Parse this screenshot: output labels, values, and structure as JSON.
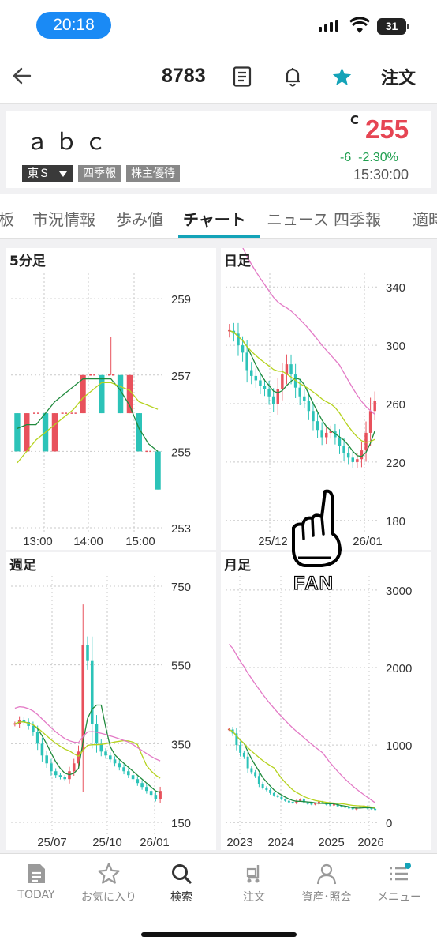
{
  "status_bar": {
    "time": "20:18",
    "battery": "31"
  },
  "header": {
    "code": "8783",
    "order_label": "注文"
  },
  "quote": {
    "name": "ａｂｃ",
    "market": "東Ｓ",
    "badge_quarterly": "四季報",
    "badge_benefit": "株主優待",
    "price_flag": "C",
    "price": "255",
    "change": "-6",
    "change_pct": "-2.30%",
    "time": "15:30:00"
  },
  "tabs": [
    "板",
    "市況情報",
    "歩み値",
    "チャート",
    "ニュース",
    "四季報",
    "適時"
  ],
  "active_tab": "チャート",
  "colors": {
    "up": "#e8515c",
    "down": "#2cc3b8",
    "ma_short": "#1f8a3c",
    "ma_mid": "#b5d21e",
    "ma_long": "#e37ac6",
    "accent": "#14a3b8",
    "price_down": "#e64553",
    "change": "#1e9e4e"
  },
  "charts": [
    {
      "title": "5分足",
      "yticks": [
        "259",
        "257",
        "255",
        "253"
      ],
      "xticks": [
        "13:00",
        "14:00",
        "15:00"
      ]
    },
    {
      "title": "日足",
      "yticks": [
        "340",
        "300",
        "260",
        "220",
        "180"
      ],
      "xticks": [
        "25/12",
        "26/01"
      ]
    },
    {
      "title": "週足",
      "yticks": [
        "750",
        "550",
        "350",
        "150"
      ],
      "xticks": [
        "25/07",
        "25/10",
        "26/01"
      ]
    },
    {
      "title": "月足",
      "yticks": [
        "3000",
        "2000",
        "1000",
        "0"
      ],
      "xticks": [
        "2023",
        "2024",
        "2025",
        "2026"
      ]
    }
  ],
  "chart_data": [
    {
      "type": "candlestick",
      "title": "5分足",
      "ylim": [
        253,
        259.5
      ],
      "ticks": [
        259,
        257,
        255,
        253
      ],
      "candles": [
        [
          256,
          256,
          255,
          255
        ],
        [
          255,
          256,
          255,
          256
        ],
        [
          256,
          256,
          256,
          256
        ],
        [
          256,
          256,
          255,
          255
        ],
        [
          255,
          256,
          255,
          256
        ],
        [
          256,
          256,
          256,
          256
        ],
        [
          256,
          256,
          256,
          256
        ],
        [
          256,
          257,
          256,
          257
        ],
        [
          257,
          257,
          257,
          257
        ],
        [
          257,
          257,
          256,
          256
        ],
        [
          257,
          258,
          257,
          257
        ],
        [
          257,
          257,
          256,
          256
        ],
        [
          256,
          257,
          256,
          257
        ],
        [
          256,
          256,
          255,
          255
        ],
        [
          255,
          255,
          255,
          255
        ],
        [
          255,
          255,
          254,
          254
        ]
      ],
      "ma_short": [
        255.6,
        255.7,
        255.7,
        256.0,
        256.3,
        256.5,
        256.7,
        256.9,
        256.9,
        256.9,
        256.9,
        256.6,
        256.2,
        255.6,
        255.2,
        255.0
      ],
      "ma_mid": [
        254.7,
        255.0,
        255.3,
        255.5,
        255.7,
        255.9,
        256.1,
        256.4,
        256.6,
        256.8,
        256.8,
        256.7,
        256.6,
        256.3,
        256.2,
        256.1
      ]
    },
    {
      "type": "candlestick",
      "title": "日足",
      "ylim": [
        175,
        345
      ],
      "ticks": [
        340,
        300,
        260,
        220,
        180
      ],
      "closes": [
        310,
        308,
        300,
        295,
        283,
        279,
        276,
        272,
        270,
        265,
        260,
        270,
        280,
        287,
        280,
        271,
        265,
        262,
        255,
        248,
        242,
        237,
        240,
        241,
        237,
        231,
        226,
        223,
        220,
        222,
        228,
        240,
        255,
        262
      ]
    },
    {
      "type": "candlestick",
      "title": "週足",
      "ylim": [
        130,
        760
      ],
      "ticks": [
        750,
        550,
        350,
        150
      ],
      "closes": [
        400,
        410,
        405,
        395,
        380,
        350,
        320,
        300,
        280,
        270,
        265,
        260,
        280,
        300,
        330,
        600,
        560,
        400,
        350,
        330,
        320,
        310,
        300,
        290,
        280,
        270,
        260,
        250,
        240,
        230,
        220,
        210,
        230
      ]
    },
    {
      "type": "candlestick",
      "title": "月足",
      "ylim": [
        -100,
        3100
      ],
      "ticks": [
        3000,
        2000,
        1000,
        0
      ],
      "closes": [
        1200,
        1150,
        1000,
        900,
        850,
        700,
        650,
        600,
        500,
        450,
        420,
        380,
        350,
        330,
        300,
        280,
        260,
        250,
        280,
        300,
        260,
        240,
        230,
        240,
        270,
        250,
        230,
        220,
        240,
        210,
        200,
        190,
        180,
        170,
        190,
        200,
        210,
        180,
        170,
        160
      ]
    }
  ],
  "overlay": {
    "text": "FAN"
  },
  "nav": [
    {
      "label": "TODAY",
      "icon": "today-doc-icon"
    },
    {
      "label": "お気に入り",
      "icon": "star-outline-icon"
    },
    {
      "label": "検索",
      "icon": "search-icon"
    },
    {
      "label": "注文",
      "icon": "cart-icon"
    },
    {
      "label": "資産･照会",
      "icon": "person-icon"
    },
    {
      "label": "メニュー",
      "icon": "menu-list-icon"
    }
  ]
}
